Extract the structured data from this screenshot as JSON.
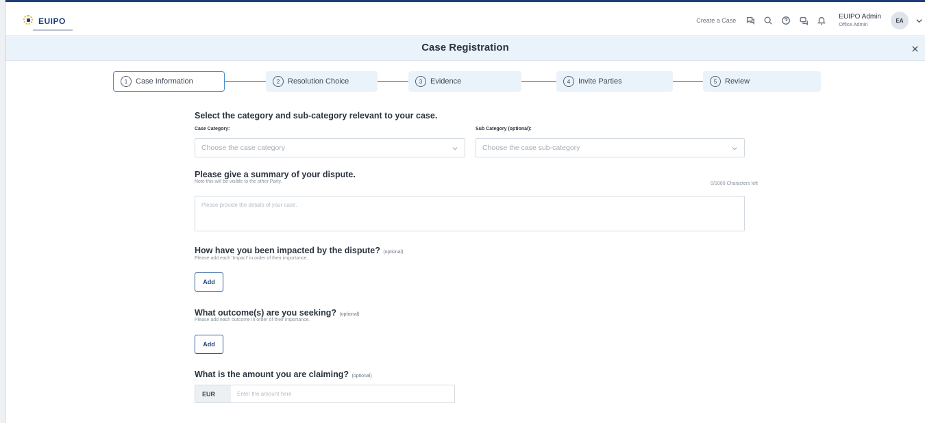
{
  "header": {
    "logo_text": "EUIPO",
    "create_case": "Create a Case",
    "user_name": "EUIPO Admin",
    "user_role": "Office Admin",
    "avatar_initials": "EA",
    "icons": [
      "chat-icon",
      "search-icon",
      "help-icon",
      "messages-icon",
      "bell-icon",
      "chevron-down-icon"
    ]
  },
  "title_bar": {
    "title": "Case Registration",
    "close_icon": "close-icon"
  },
  "steps": [
    {
      "number": "1",
      "label": "Case Information",
      "active": true
    },
    {
      "number": "2",
      "label": "Resolution Choice",
      "active": false
    },
    {
      "number": "3",
      "label": "Evidence",
      "active": false
    },
    {
      "number": "4",
      "label": "Invite Parties",
      "active": false
    },
    {
      "number": "5",
      "label": "Review",
      "active": false
    }
  ],
  "form": {
    "category_section": {
      "title": "Select the category and sub-category relevant to your case.",
      "case_category_label": "Case Category:",
      "case_category_placeholder": "Choose the case category",
      "sub_category_label": "Sub Category (optional):",
      "sub_category_placeholder": "Choose the case sub-category"
    },
    "summary_section": {
      "title": "Please give a summary of your dispute.",
      "help": "Note this will be visible to the other Party.",
      "counter": "0/1000 Characters left",
      "placeholder": "Please provide the details of your case."
    },
    "impact_section": {
      "title": "How have you been impacted by the dispute?",
      "optional": "(optional)",
      "help": "Please add each 'Impact' in order of their importance.",
      "add_label": "Add"
    },
    "outcome_section": {
      "title": "What outcome(s) are you seeking?",
      "optional": "(optional)",
      "help": "Please add each outcome in order of their importance.",
      "add_label": "Add"
    },
    "amount_section": {
      "title": "What is the amount you are claiming?",
      "optional": "(optional)",
      "currency": "EUR",
      "placeholder": "Enter the amount here"
    }
  },
  "colors": {
    "brand": "#1c3f7a",
    "step_bg": "#eaf2fa",
    "active_border": "#4a8fd1"
  }
}
